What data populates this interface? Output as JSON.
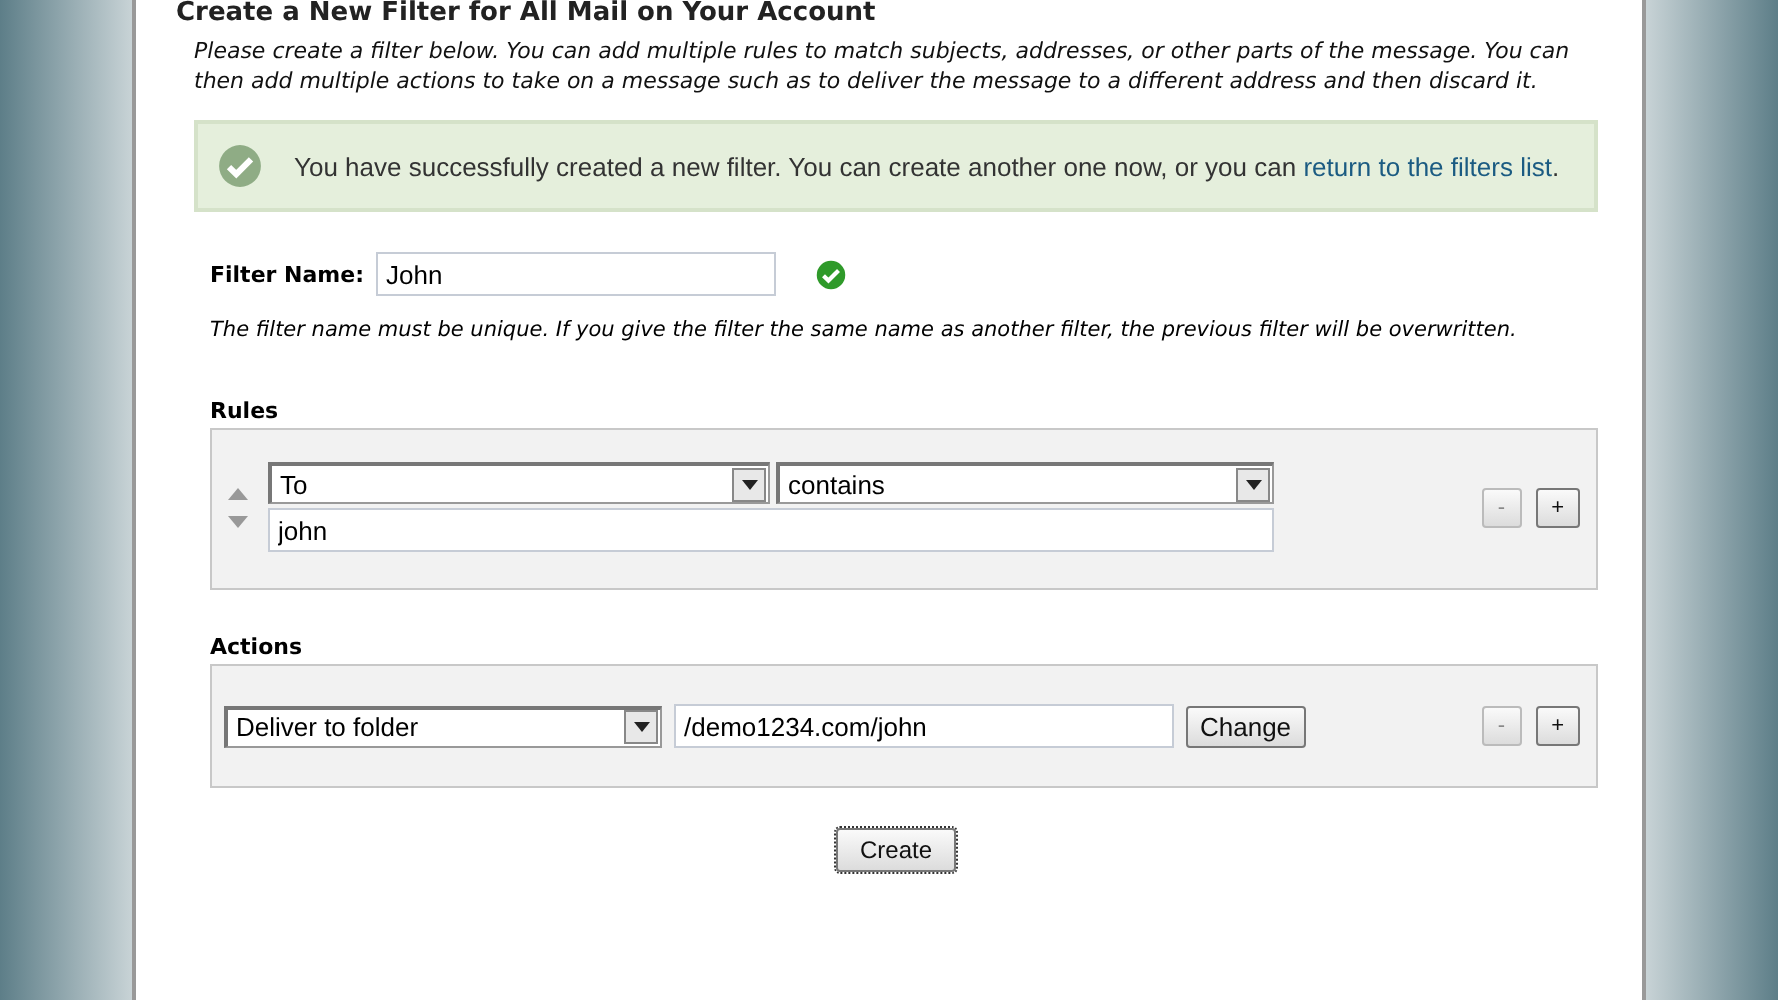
{
  "heading": "Create a New Filter for All Mail on Your Account",
  "intro": "Please create a filter below. You can add multiple rules to match subjects, addresses, or other parts of the message. You can then add multiple actions to take on a message such as to deliver the message to a different address and then discard it.",
  "notice": {
    "text": "You have successfully created a new filter. You can create another one now, or you can ",
    "link": "return to the filters list",
    "end": "."
  },
  "filter_name": {
    "label": "Filter Name:",
    "value": "John",
    "valid": true
  },
  "name_hint": "The filter name must be unique. If you give the filter the same name as another filter, the previous filter will be overwritten.",
  "rules": {
    "title": "Rules",
    "items": [
      {
        "field": "To",
        "operator": "contains",
        "value": "john"
      }
    ],
    "buttons": [
      "-",
      "+"
    ]
  },
  "actions": {
    "title": "Actions",
    "items": [
      {
        "action": "Deliver to folder",
        "value": "/demo1234.com/john",
        "button": "Change"
      }
    ],
    "buttons": [
      "-",
      "+"
    ]
  },
  "submit": "Create"
}
